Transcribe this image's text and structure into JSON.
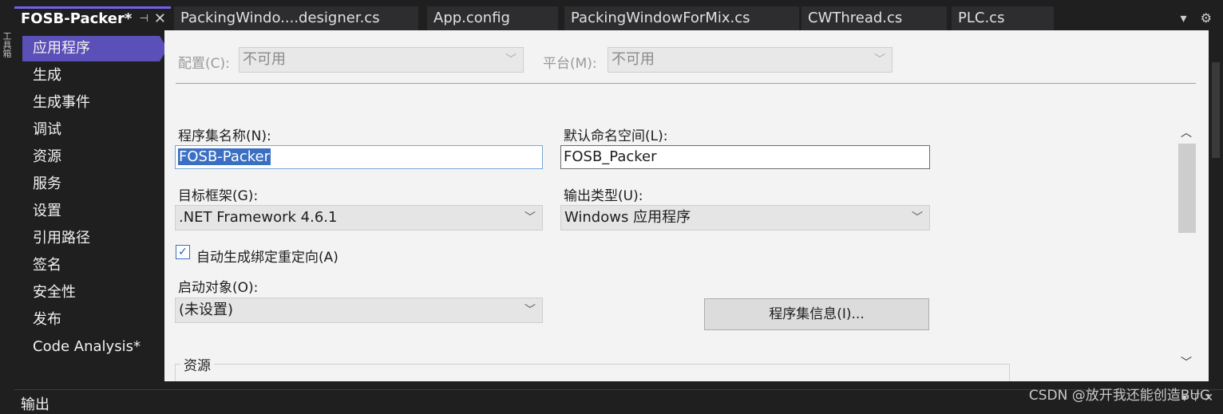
{
  "left_rail": {
    "text": "工具箱"
  },
  "tabs": [
    {
      "label": "FOSB-Packer*",
      "active": true
    },
    {
      "label": "PackingWindo....designer.cs"
    },
    {
      "label": "App.config"
    },
    {
      "label": "PackingWindowForMix.cs"
    },
    {
      "label": "CWThread.cs"
    },
    {
      "label": "PLC.cs"
    }
  ],
  "tab_icons": {
    "pin": "pin-icon",
    "close": "close-icon",
    "dropdown": "dropdown-icon",
    "settings": "gear-icon"
  },
  "sidebar": {
    "items": [
      {
        "label": "应用程序",
        "active": true
      },
      {
        "label": "生成"
      },
      {
        "label": "生成事件"
      },
      {
        "label": "调试"
      },
      {
        "label": "资源"
      },
      {
        "label": "服务"
      },
      {
        "label": "设置"
      },
      {
        "label": "引用路径"
      },
      {
        "label": "签名"
      },
      {
        "label": "安全性"
      },
      {
        "label": "发布"
      },
      {
        "label": "Code Analysis*"
      }
    ]
  },
  "form": {
    "config_label": "配置(C):",
    "config_value": "不可用",
    "platform_label": "平台(M):",
    "platform_value": "不可用",
    "assembly_name_label": "程序集名称(N):",
    "assembly_name_value": "FOSB-Packer",
    "default_namespace_label": "默认命名空间(L):",
    "default_namespace_value": "FOSB_Packer",
    "target_framework_label": "目标框架(G):",
    "target_framework_value": ".NET Framework 4.6.1",
    "output_type_label": "输出类型(U):",
    "output_type_value": "Windows 应用程序",
    "auto_binding_label": "自动生成绑定重定向(A)",
    "auto_binding_checked": true,
    "startup_object_label": "启动对象(O):",
    "startup_object_value": "(未设置)",
    "assembly_info_button": "程序集信息(I)...",
    "resources_group_label": "资源"
  },
  "output_panel": {
    "title": "输出",
    "tools": "▾ ⊤ ✕"
  },
  "watermark": "CSDN @放开我还能创造BUG",
  "colors": {
    "accent": "#7160e8",
    "sidebar_active": "#5b4fb8",
    "selection": "#3a6fc4"
  }
}
